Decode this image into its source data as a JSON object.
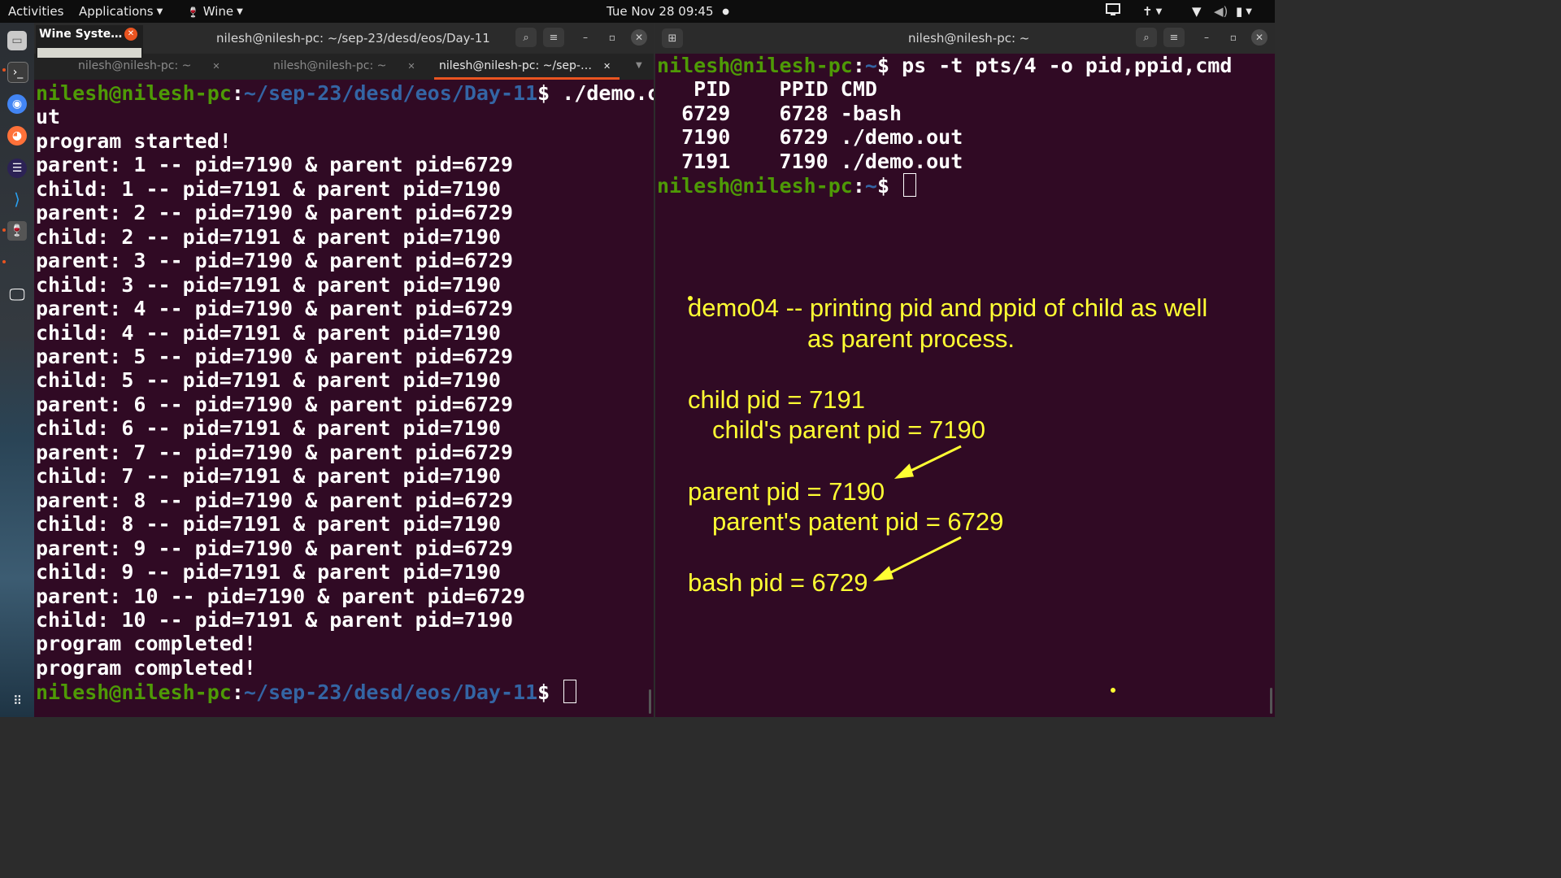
{
  "topbar": {
    "activities": "Activities",
    "applications": "Applications",
    "wine": "Wine",
    "clock": "Tue Nov 28  09:45"
  },
  "wine_popup": {
    "title": "Wine Syste…"
  },
  "left_window": {
    "title": "nilesh@nilesh-pc: ~/sep-23/desd/eos/Day-11",
    "tabs": [
      {
        "label": "nilesh@nilesh-pc: ~",
        "active": false
      },
      {
        "label": "nilesh@nilesh-pc: ~",
        "active": false
      },
      {
        "label": "nilesh@nilesh-pc: ~/sep-…",
        "active": true
      }
    ],
    "prompt_user": "nilesh@nilesh-pc",
    "prompt_path": "~/sep-23/desd/eos/Day-11",
    "prompt_end": "$",
    "command_line1": " ./demo.o",
    "command_line2": "ut",
    "output": [
      "program started!",
      "parent: 1 -- pid=7190 & parent pid=6729",
      "child: 1 -- pid=7191 & parent pid=7190",
      "parent: 2 -- pid=7190 & parent pid=6729",
      "child: 2 -- pid=7191 & parent pid=7190",
      "parent: 3 -- pid=7190 & parent pid=6729",
      "child: 3 -- pid=7191 & parent pid=7190",
      "parent: 4 -- pid=7190 & parent pid=6729",
      "child: 4 -- pid=7191 & parent pid=7190",
      "parent: 5 -- pid=7190 & parent pid=6729",
      "child: 5 -- pid=7191 & parent pid=7190",
      "parent: 6 -- pid=7190 & parent pid=6729",
      "child: 6 -- pid=7191 & parent pid=7190",
      "parent: 7 -- pid=7190 & parent pid=6729",
      "child: 7 -- pid=7191 & parent pid=7190",
      "parent: 8 -- pid=7190 & parent pid=6729",
      "child: 8 -- pid=7191 & parent pid=7190",
      "parent: 9 -- pid=7190 & parent pid=6729",
      "child: 9 -- pid=7191 & parent pid=7190",
      "parent: 10 -- pid=7190 & parent pid=6729",
      "child: 10 -- pid=7191 & parent pid=7190",
      "program completed!",
      "program completed!"
    ],
    "final_prompt_end": "$ "
  },
  "right_window": {
    "title": "nilesh@nilesh-pc: ~",
    "prompt_user": "nilesh@nilesh-pc",
    "prompt_path": "~",
    "prompt_end": "$",
    "command": " ps -t pts/4 -o pid,ppid,cmd",
    "ps_header": "   PID    PPID CMD",
    "ps_rows": [
      "  6729    6728 -bash",
      "  7190    6729 ./demo.out",
      "  7191    7190 ./demo.out"
    ],
    "final_prompt_end": "$ "
  },
  "annotations": {
    "line1": "demo04 -- printing pid and ppid of child as well",
    "line2": "as parent process.",
    "child_pid": "child pid = 7191",
    "child_parent_pid": "child's parent pid = 7190",
    "parent_pid": "parent pid = 7190",
    "parent_parent_pid": "parent's patent pid = 6729",
    "bash_pid": "bash pid = 6729",
    "color": "#ffff33"
  },
  "colors": {
    "terminal_bg": "#300a24",
    "prompt_green": "#4e9a06",
    "prompt_blue": "#3465a4",
    "accent": "#e95420"
  }
}
